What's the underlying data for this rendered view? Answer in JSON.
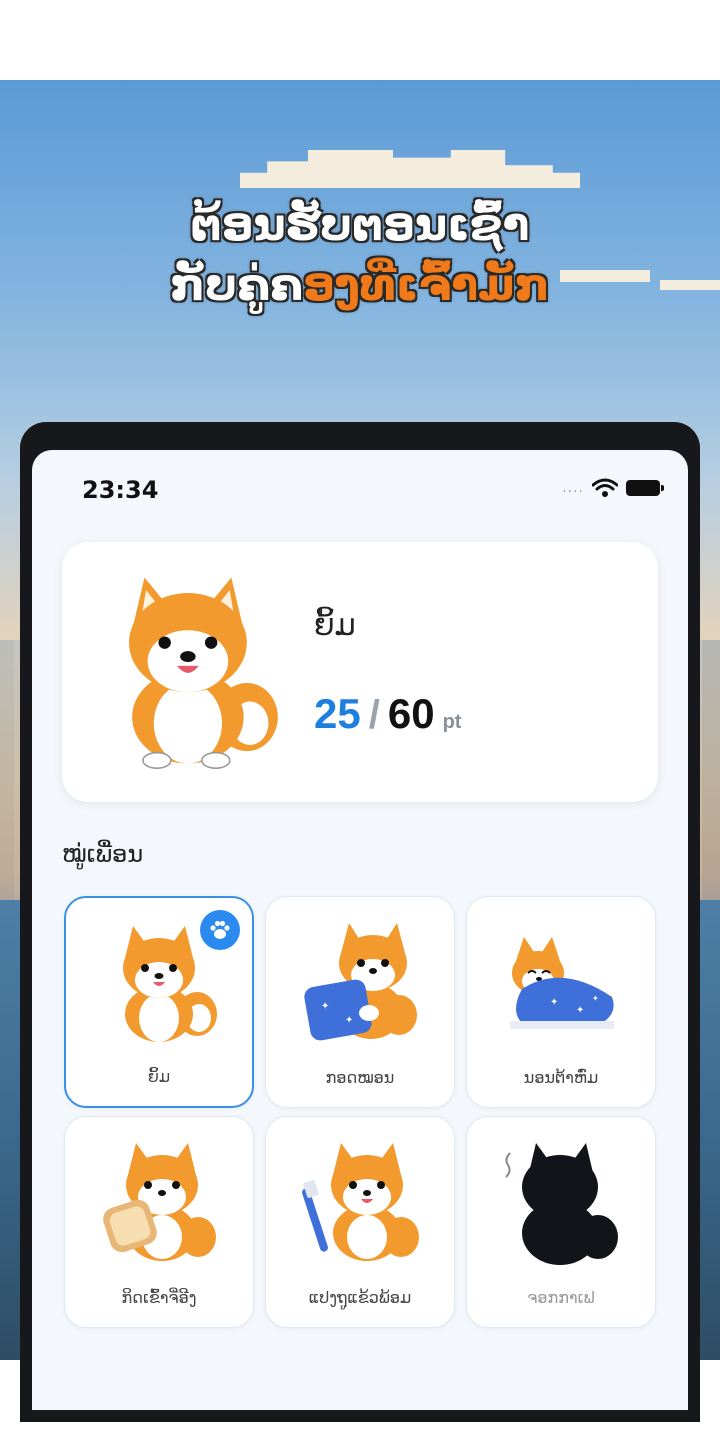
{
  "promo": {
    "line1": "ຕ້ອນຮັບຕອນເຊົ້າ",
    "line2_plain": "ກັບຄູ່ຄ",
    "line2_highlight": "ອງທີ່ເຈົ້າມັກ"
  },
  "status_bar": {
    "time": "23:34",
    "signal_dots": "....",
    "icons": [
      "wifi-icon",
      "battery-icon"
    ]
  },
  "current_pet": {
    "name": "ຍິ້ມ",
    "points": "25",
    "separator": "/",
    "max_points": "60",
    "unit": "pt"
  },
  "collection": {
    "title": "ໝູ່ເພື່ອນ",
    "items": [
      {
        "label": "ຍິ້ມ",
        "selected": true,
        "icon": "shiba-smile"
      },
      {
        "label": "ກອດໝອນ",
        "selected": false,
        "icon": "shiba-pillow"
      },
      {
        "label": "ນອນຕ້າຫົ່ມ",
        "selected": false,
        "icon": "shiba-blanket"
      },
      {
        "label": "ກິດເຂົ້າຈີ່ອີງ",
        "selected": false,
        "icon": "shiba-toast"
      },
      {
        "label": "ແປງຖູແຂ້ວພ້ອມ",
        "selected": false,
        "icon": "shiba-toothbrush"
      },
      {
        "label": "ຈອກກາເຟ",
        "selected": false,
        "locked": true,
        "icon": "locked-silhouette"
      }
    ]
  },
  "colors": {
    "accent": "#1e7fe0",
    "highlight": "#f07a1a",
    "selected_border": "#3a8fe6"
  }
}
